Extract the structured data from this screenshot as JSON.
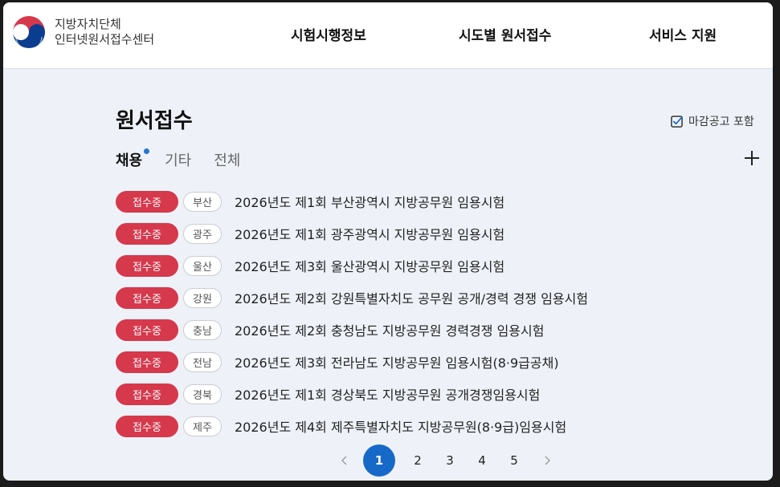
{
  "header": {
    "brand_line1": "지방자치단체",
    "brand_line2": "인터넷원서접수센터",
    "nav": [
      "시험시행정보",
      "시도별 원서접수",
      "서비스 지원"
    ]
  },
  "page": {
    "title": "원서접수",
    "include_closed_label": "마감공고 포함",
    "tabs": [
      "채용",
      "기타",
      "전체"
    ]
  },
  "exams": [
    {
      "status": "접수중",
      "region": "부산",
      "title": "2026년도 제1회 부산광역시 지방공무원 임용시험"
    },
    {
      "status": "접수중",
      "region": "광주",
      "title": "2026년도 제1회 광주광역시 지방공무원 임용시험"
    },
    {
      "status": "접수중",
      "region": "울산",
      "title": "2026년도 제3회 울산광역시 지방공무원 임용시험"
    },
    {
      "status": "접수중",
      "region": "강원",
      "title": "2026년도 제2회 강원특별자치도 공무원 공개/경력 경쟁 임용시험"
    },
    {
      "status": "접수중",
      "region": "충남",
      "title": "2026년도 제2회 충청남도 지방공무원 경력경쟁 임용시험"
    },
    {
      "status": "접수중",
      "region": "전남",
      "title": "2026년도 제3회 전라남도 지방공무원 임용시험(8·9급공채)"
    },
    {
      "status": "접수중",
      "region": "경북",
      "title": "2026년도 제1회 경상북도 지방공무원 공개경쟁임용시험"
    },
    {
      "status": "접수중",
      "region": "제주",
      "title": "2026년도 제4회 제주특별자치도 지방공무원(8·9급)임용시험"
    }
  ],
  "pagination": {
    "pages": [
      "1",
      "2",
      "3",
      "4",
      "5"
    ],
    "current": "1"
  },
  "colors": {
    "status_badge": "#d6384c",
    "accent_blue": "#1769c8",
    "background": "#eef2f8"
  }
}
